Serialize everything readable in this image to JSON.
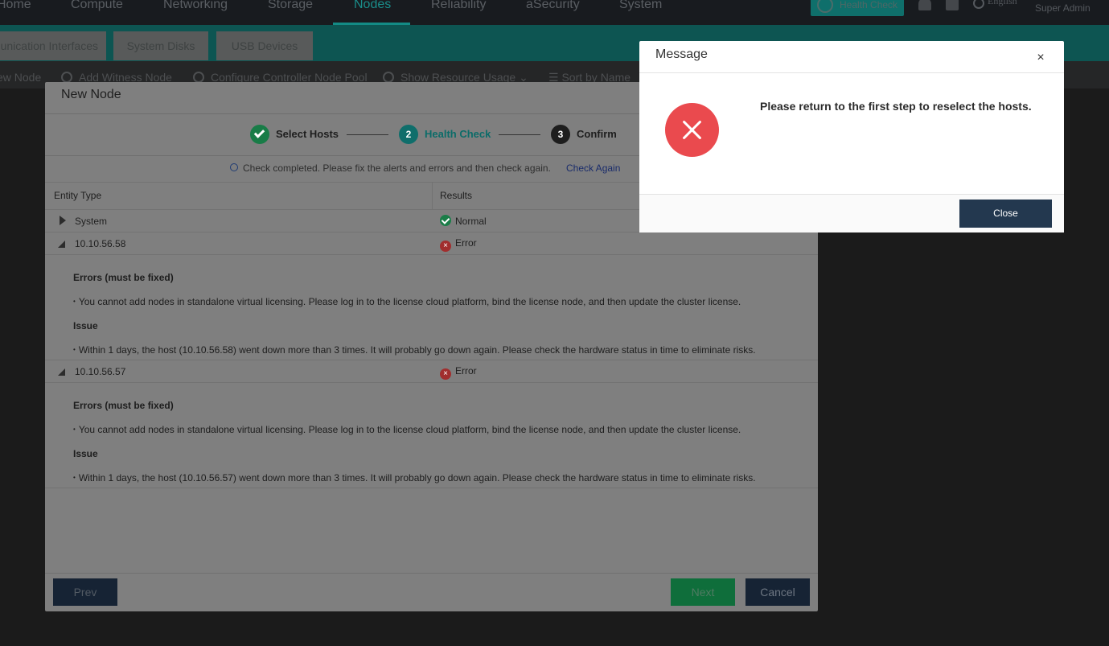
{
  "top_nav": {
    "items": [
      "Home",
      "Compute",
      "Networking",
      "Storage",
      "Nodes",
      "Reliability",
      "aSecurity",
      "System"
    ],
    "active": "Nodes",
    "health_check_label": "Health Check",
    "language": "English",
    "user": "Super Admin"
  },
  "sub_tabs": [
    "unication Interfaces",
    "System Disks",
    "USB Devices"
  ],
  "toolbar": {
    "new_node": "ew Node",
    "add_witness": "Add Witness Node",
    "configure_pool": "Configure Controller Node Pool",
    "show_usage": "Show Resource Usage",
    "sort_by": "Sort by Name"
  },
  "wizard": {
    "title": "New Node",
    "steps": [
      {
        "number": "1",
        "label": "Select Hosts",
        "state": "done"
      },
      {
        "number": "2",
        "label": "Health Check",
        "state": "active"
      },
      {
        "number": "3",
        "label": "Confirm",
        "state": "pending"
      }
    ],
    "notice": "Check completed. Please fix the alerts and errors and then check again.",
    "check_again": "Check Again",
    "columns": {
      "entity": "Entity Type",
      "results": "Results"
    },
    "rows": [
      {
        "entity": "System",
        "result": "Normal"
      },
      {
        "entity": "10.10.56.58",
        "result": "Error",
        "errors_heading": "Errors (must be fixed)",
        "error": "You cannot add nodes in standalone virtual licensing. Please log in to the license cloud platform, bind the license node, and then update the cluster license.",
        "issue_heading": "Issue",
        "issue": "Within 1 days, the host (10.10.56.58) went down more than 3 times. It will probably go down again. Please check the hardware status in time to eliminate risks."
      },
      {
        "entity": "10.10.56.57",
        "result": "Error",
        "errors_heading": "Errors (must be fixed)",
        "error": "You cannot add nodes in standalone virtual licensing. Please log in to the license cloud platform, bind the license node, and then update the cluster license.",
        "issue_heading": "Issue",
        "issue": "Within 1 days, the host (10.10.56.57) went down more than 3 times. It will probably go down again. Please check the hardware status in time to eliminate risks."
      }
    ],
    "buttons": {
      "prev": "Prev",
      "next": "Next",
      "cancel": "Cancel"
    }
  },
  "modal": {
    "title": "Message",
    "message": "Please return to the first step to reselect the hosts.",
    "close_label": "Close",
    "close_icon": "×"
  },
  "colors": {
    "accent_teal": "#138b85",
    "success_green": "#1e9e5b",
    "error_red": "#ea4a4e",
    "primary_navy": "#23384f"
  }
}
